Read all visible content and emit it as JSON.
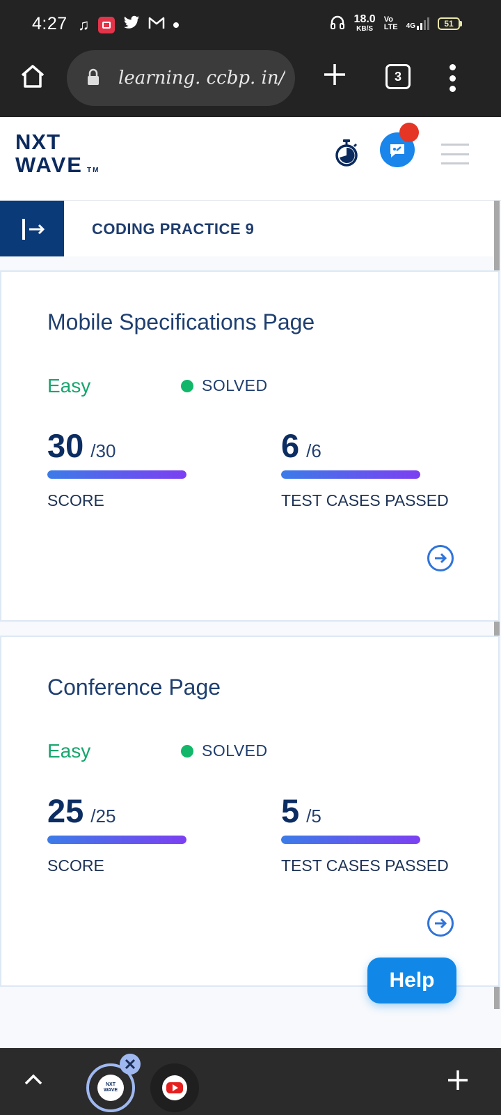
{
  "status_bar": {
    "time": "4:27",
    "network_speed_top": "18.0",
    "network_speed_bottom": "KB/S",
    "network_type_top": "Vo",
    "network_type_bottom": "LTE",
    "signal_label": "4G",
    "battery": "51"
  },
  "browser": {
    "url": "learning. ccbp. in/pı",
    "tabs_count": "3"
  },
  "header": {
    "logo_line1": "NXT",
    "logo_line2": "WAVE",
    "logo_tm": "TM"
  },
  "page": {
    "title": "CODING PRACTICE 9"
  },
  "cards": [
    {
      "title": "Mobile Specifications Page",
      "difficulty": "Easy",
      "status": "SOLVED",
      "score_value": "30",
      "score_total": "/30",
      "score_label": "SCORE",
      "score_progress": 1.0,
      "tests_value": "6",
      "tests_total": "/6",
      "tests_label": "TEST CASES PASSED",
      "tests_progress": 1.0
    },
    {
      "title": "Conference Page",
      "difficulty": "Easy",
      "status": "SOLVED",
      "score_value": "25",
      "score_total": "/25",
      "score_label": "SCORE",
      "score_progress": 1.0,
      "tests_value": "5",
      "tests_total": "/5",
      "tests_label": "TEST CASES PASSED",
      "tests_progress": 1.0
    }
  ],
  "help_button": {
    "label": "Help"
  },
  "bottom_tabs": {
    "logo_text_1": "NXT",
    "logo_text_2": "WAVE"
  },
  "colors": {
    "accent_blue": "#1188e8",
    "solved_green": "#12b76a",
    "easy_green": "#16a66e",
    "dark_navy": "#0b3a78"
  }
}
